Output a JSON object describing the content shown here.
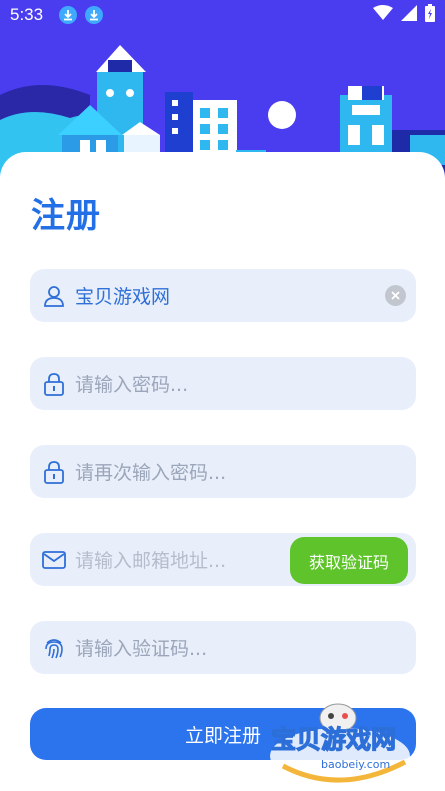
{
  "status_bar": {
    "time": "5:33"
  },
  "page": {
    "title": "注册"
  },
  "form": {
    "username": {
      "value": "宝贝游戏网"
    },
    "password": {
      "placeholder": "请输入密码..."
    },
    "password_confirm": {
      "placeholder": "请再次输入密码..."
    },
    "email": {
      "placeholder": "请输入邮箱地址...",
      "code_button": "获取验证码"
    },
    "code": {
      "placeholder": "请输入验证码..."
    },
    "submit_label": "立即注册"
  },
  "watermark": {
    "logo_text": "宝贝游戏网",
    "url": "baobeiy.com"
  },
  "colors": {
    "accent": "#2c74ee",
    "title": "#2370e6",
    "field_bg": "#e9effa",
    "code_button": "#5fc42b",
    "hero_bg": "#4a3df0"
  }
}
